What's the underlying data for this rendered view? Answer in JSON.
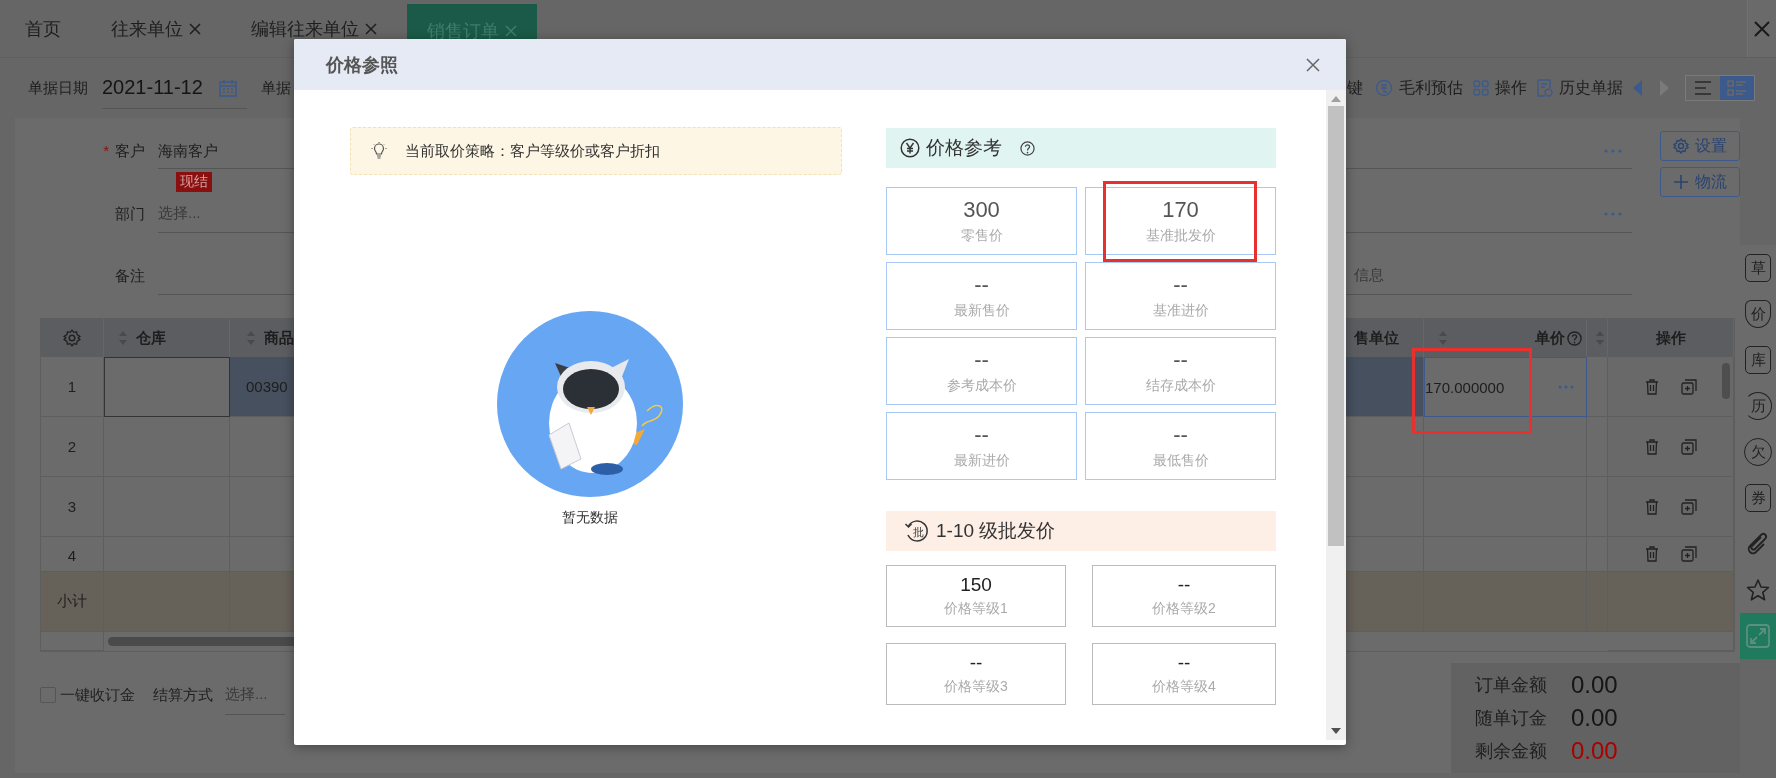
{
  "tabs": [
    {
      "label": "首页",
      "closable": false,
      "selected": false
    },
    {
      "label": "往来单位",
      "closable": true,
      "selected": false
    },
    {
      "label": "编辑往来单位",
      "closable": true,
      "selected": false
    },
    {
      "label": "销售订单",
      "closable": true,
      "selected": true
    }
  ],
  "header": {
    "date_label": "单据日期",
    "date": "2021-11-12",
    "number_label": "单据",
    "actions": [
      {
        "label": "键",
        "kind": "text"
      },
      {
        "label": "毛利预估",
        "kind": "coin"
      },
      {
        "label": "操作",
        "kind": "grid"
      },
      {
        "label": "历史单据",
        "kind": "history"
      }
    ],
    "views": [
      {
        "kind": "list",
        "selected": false
      },
      {
        "kind": "detail",
        "selected": true
      }
    ]
  },
  "form": {
    "customer": {
      "label": "客户",
      "required_mark": "*",
      "value": "海南客户",
      "tag": "现结"
    },
    "department": {
      "label": "部门",
      "placeholder": "选择..."
    },
    "remark": {
      "label": "备注"
    },
    "logistics_hint": "信息",
    "buttons": [
      {
        "label": "设置",
        "kind": "settings"
      },
      {
        "label": "物流",
        "kind": "add"
      }
    ]
  },
  "table": {
    "columns": [
      {
        "kind": "settings"
      },
      {
        "kind": "text",
        "label": "仓库",
        "sortable": true
      },
      {
        "kind": "text",
        "label": "商品",
        "sortable": true
      },
      {
        "kind": "end",
        "label": "售单位",
        "sortable": false
      },
      {
        "kind": "price",
        "label": "单价",
        "sortable": true
      },
      {
        "kind": "partial",
        "sortable": true
      },
      {
        "kind": "center",
        "label": "操作",
        "sortable": false
      }
    ],
    "rows": [
      {
        "index": "1",
        "selected": true,
        "product": "00390",
        "unit_price": "170.000000",
        "marked": true
      },
      {
        "index": "2",
        "selected": false,
        "marked": false
      },
      {
        "index": "3",
        "selected": false,
        "marked": false
      },
      {
        "index": "4",
        "selected": false,
        "marked": false
      }
    ],
    "subtotal_label": "小计"
  },
  "footer": {
    "deposit": {
      "label": "一键收订金",
      "checked": false
    },
    "settlement": {
      "label": "结算方式",
      "placeholder": "选择..."
    },
    "totals": [
      {
        "label": "订单金额",
        "value": "0.00",
        "alert": false
      },
      {
        "label": "随单订金",
        "value": "0.00",
        "alert": false
      },
      {
        "label": "剩余金额",
        "value": "0.00",
        "alert": true
      }
    ]
  },
  "sidebar": [
    {
      "label": "草",
      "kind": "box"
    },
    {
      "label": "价",
      "kind": "shield"
    },
    {
      "label": "库",
      "kind": "box"
    },
    {
      "label": "历",
      "kind": "history"
    },
    {
      "label": "欠",
      "kind": "circle"
    },
    {
      "label": "券",
      "kind": "box"
    },
    {
      "kind": "attach"
    },
    {
      "kind": "star"
    },
    {
      "kind": "expand"
    }
  ],
  "dialog": {
    "title": "价格参照",
    "notice": "当前取价策略：客户等级价或客户折扣",
    "empty_text": "暂无数据",
    "reference": {
      "title": "价格参考",
      "cards": [
        {
          "value": "300",
          "label": "零售价",
          "marked": false
        },
        {
          "value": "170",
          "label": "基准批发价",
          "marked": true
        },
        {
          "value": "--",
          "label": "最新售价",
          "marked": false
        },
        {
          "value": "--",
          "label": "基准进价",
          "marked": false
        },
        {
          "value": "--",
          "label": "参考成本价",
          "marked": false
        },
        {
          "value": "--",
          "label": "结存成本价",
          "marked": false
        },
        {
          "value": "--",
          "label": "最新进价",
          "marked": false
        },
        {
          "value": "--",
          "label": "最低售价",
          "marked": false
        }
      ]
    },
    "wholesale": {
      "icon_text": "批",
      "title": "1-10 级批发价",
      "levels": [
        {
          "value": "150",
          "label": "价格等级1"
        },
        {
          "value": "--",
          "label": "价格等级2"
        },
        {
          "value": "--",
          "label": "价格等级3"
        },
        {
          "value": "--",
          "label": "价格等级4"
        }
      ]
    }
  }
}
